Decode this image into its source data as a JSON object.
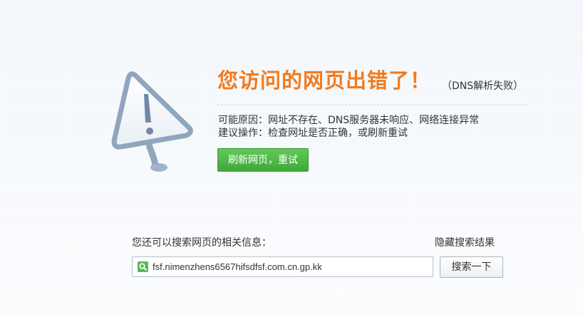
{
  "error": {
    "title": "您访问的网页出错了！",
    "subtitle": "（DNS解析失败）",
    "reason": "可能原因：网址不存在、DNS服务器未响应、网络连接异常",
    "advice": "建议操作：检查网址是否正确，或刷新重试",
    "refresh_label": "刷新网页，重试"
  },
  "search": {
    "hint": "您还可以搜索网页的相关信息：",
    "hide_label": "隐藏搜索结果",
    "query": "fsf.nimenzhens6567hifsdfsf.com.cn.gp.kk",
    "button_label": "搜索一下"
  },
  "icons": {
    "warning": "warning-triangle-icon",
    "search": "search-icon"
  },
  "colors": {
    "title": "#f17b1f",
    "button_green": "#4cb845"
  }
}
